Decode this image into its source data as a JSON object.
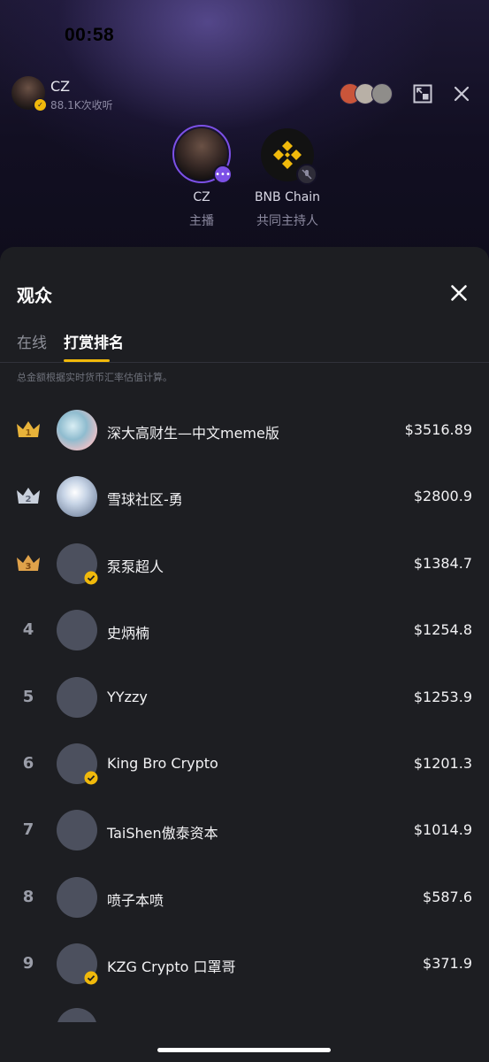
{
  "status_bar": {
    "time": "00:58"
  },
  "space": {
    "host_name": "CZ",
    "listen_count": "88.1K次收听"
  },
  "speakers": [
    {
      "name": "CZ",
      "role": "主播"
    },
    {
      "name": "BNB Chain",
      "role": "共同主持人"
    }
  ],
  "sheet": {
    "title": "观众",
    "tabs": [
      {
        "label": "在线"
      },
      {
        "label": "打赏排名"
      }
    ],
    "active_tab": "打赏排名",
    "note": "总金额根据实时货币汇率估值计算。"
  },
  "ranking": [
    {
      "rank": "1",
      "name": "深大高财生—中文meme版",
      "amount": "$3516.89"
    },
    {
      "rank": "2",
      "name": "雪球社区-勇",
      "amount": "$2800.9"
    },
    {
      "rank": "3",
      "name": "泵泵超人",
      "amount": "$1384.7"
    },
    {
      "rank": "4",
      "name": "史炳楠",
      "amount": "$1254.8"
    },
    {
      "rank": "5",
      "name": "YYzzy",
      "amount": "$1253.9"
    },
    {
      "rank": "6",
      "name": "King Bro Crypto",
      "amount": "$1201.3"
    },
    {
      "rank": "7",
      "name": "TaiShen傲泰资本",
      "amount": "$1014.9"
    },
    {
      "rank": "8",
      "name": "喷子本喷",
      "amount": "$587.6"
    },
    {
      "rank": "9",
      "name": "KZG Crypto 口罩哥",
      "amount": "$371.9"
    }
  ],
  "icons": {
    "minimize": "picture-in-picture-icon",
    "close": "close-icon",
    "crown": "crown-icon",
    "verified": "verified-badge-icon",
    "mic_off": "mic-off-icon",
    "more": "more-icon"
  },
  "colors": {
    "accent": "#f0b90b",
    "host_ring": "#7c50e6",
    "sheet_bg": "#1d1e22",
    "gold_crown": "#e8b33a",
    "silver_crown": "#c9d0dc",
    "bronze_crown": "#e0a24a"
  }
}
